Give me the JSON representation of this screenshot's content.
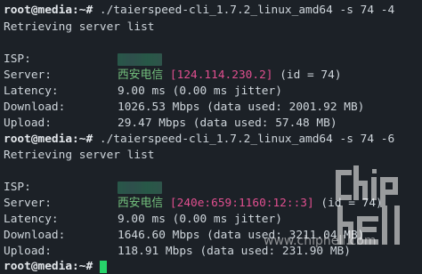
{
  "prompt": "root@media:~#",
  "session1": {
    "command": "./taierspeed-cli_1.7.2_linux_amd64 -s 74 -4",
    "retrieving": "Retrieving server list",
    "isp_label": "ISP:",
    "server_label": "Server:",
    "server_name": "西安电信",
    "server_ip": "[124.114.230.2]",
    "server_id": "(id = 74)",
    "latency_label": "Latency:",
    "latency_value": "9.00 ms (0.00 ms jitter)",
    "download_label": "Download:",
    "download_value": "1026.53 Mbps (data used: 2001.92 MB)",
    "upload_label": "Upload:",
    "upload_value": "29.47 Mbps (data used: 57.48 MB)"
  },
  "session2": {
    "command": "./taierspeed-cli_1.7.2_linux_amd64 -s 74 -6",
    "retrieving": "Retrieving server list",
    "isp_label": "ISP:",
    "server_label": "Server:",
    "server_name": "西安电信",
    "server_ip": "[240e:659:1160:12::3]",
    "server_id": "(id = 74)",
    "latency_label": "Latency:",
    "latency_value": "9.00 ms (0.00 ms jitter)",
    "download_label": "Download:",
    "download_value": "1646.60 Mbps (data used: 3211.04 MB)",
    "upload_label": "Upload:",
    "upload_value": "118.91 Mbps (data used: 231.90 MB)"
  },
  "watermark": {
    "logo_text": "chip hell",
    "url": "www.chiphell.com"
  },
  "colors": {
    "background": "#1c2127",
    "server_name": "#74c27e",
    "server_ip": "#e04f8f",
    "cursor": "#27d46a"
  }
}
